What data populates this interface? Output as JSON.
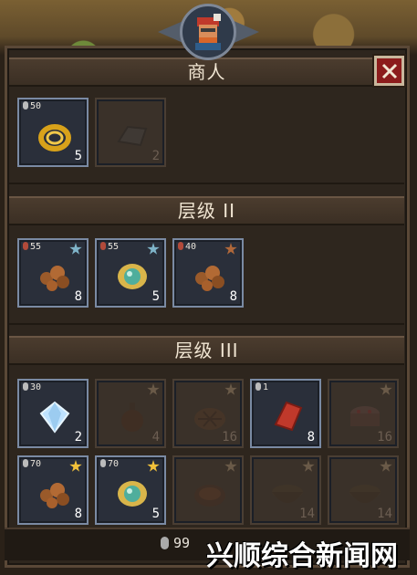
{
  "sections": {
    "merchant_title": "商人",
    "tier2_title": "层级 II",
    "tier3_title": "层级 III"
  },
  "merchant_slots": [
    {
      "item": "gold-rope-icon",
      "price": "50",
      "qty": "5",
      "locked": false
    },
    {
      "item": "stone-ingot-icon",
      "price": "",
      "qty": "2",
      "locked": true
    }
  ],
  "tier2_slots": [
    {
      "item": "nuts-icon",
      "price": "55",
      "qty": "8",
      "star": "#7fb4c9"
    },
    {
      "item": "gem-orb-icon",
      "price": "55",
      "qty": "5",
      "star": "#7fb4c9"
    },
    {
      "item": "nuts-icon",
      "price": "40",
      "qty": "8",
      "star": "#b0683a"
    }
  ],
  "tier3_slots": [
    {
      "item": "diamond-icon",
      "price": "30",
      "qty": "2",
      "locked": false
    },
    {
      "item": "potion-icon",
      "price": "",
      "qty": "4",
      "locked": true
    },
    {
      "item": "pie-icon",
      "price": "",
      "qty": "16",
      "locked": true
    },
    {
      "item": "cloth-icon",
      "price": "1",
      "qty": "8",
      "locked": false
    },
    {
      "item": "cake-icon",
      "price": "",
      "qty": "16",
      "locked": true
    },
    {
      "item": "nuts-icon",
      "price": "70",
      "qty": "8",
      "locked": false,
      "star": "#f2c13a"
    },
    {
      "item": "gem-orb-icon",
      "price": "70",
      "qty": "5",
      "locked": false,
      "star": "#f2c13a"
    },
    {
      "item": "stew-icon",
      "price": "",
      "qty": "",
      "locked": true
    },
    {
      "item": "bowl-icon",
      "price": "",
      "qty": "14",
      "locked": true
    },
    {
      "item": "bowl-icon",
      "price": "",
      "qty": "14",
      "locked": true
    }
  ],
  "footer": {
    "coins": "99",
    "watermark": "兴顺综合新闻网"
  },
  "colors": {
    "close_button": "#8c1c1c",
    "slot_border": "#7a8aa3",
    "gold_star": "#f2c13a",
    "silver_star": "#7fb4c9",
    "bronze_star": "#b0683a"
  }
}
